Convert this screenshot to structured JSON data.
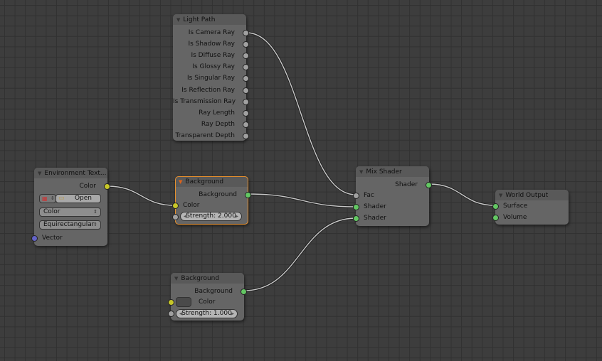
{
  "colors": {
    "background": "#3d3d3d",
    "grid": "#313131",
    "node_body": "#656565",
    "node_header": "#595959",
    "active_outline": "#e8902c",
    "socket_shader": "#63c763",
    "socket_color": "#c7c729",
    "socket_float": "#a1a1a1",
    "socket_vector": "#6363c7"
  },
  "nodes": {
    "light_path": {
      "title": "Light Path",
      "outputs": [
        "Is Camera Ray",
        "Is Shadow Ray",
        "Is Diffuse Ray",
        "Is Glossy Ray",
        "Is Singular Ray",
        "Is Reflection Ray",
        "Is Transmission Ray",
        "Ray Length",
        "Ray Depth",
        "Transparent Depth"
      ]
    },
    "env_texture": {
      "title": "Environment Text...",
      "output": "Color",
      "open_label": "Open",
      "color_mode": "Color",
      "projection": "Equirectangular",
      "input": "Vector"
    },
    "background1": {
      "title": "Background",
      "output": "Background",
      "color_input": "Color",
      "strength": "Strength:  2.000"
    },
    "background2": {
      "title": "Background",
      "output": "Background",
      "color_input": "Color",
      "strength": "Strength:  1.000"
    },
    "mix_shader": {
      "title": "Mix Shader",
      "output": "Shader",
      "inputs": [
        "Fac",
        "Shader",
        "Shader"
      ]
    },
    "world_output": {
      "title": "World Output",
      "inputs": [
        "Surface",
        "Volume"
      ]
    }
  }
}
